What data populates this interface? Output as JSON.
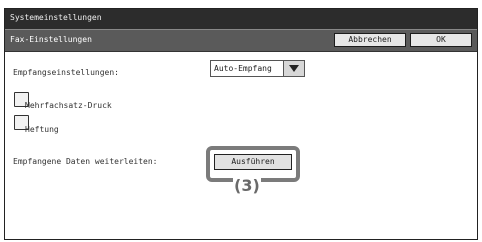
{
  "window": {
    "title": "Systemeinstellungen"
  },
  "header": {
    "title": "Fax-Einstellungen",
    "cancel_label": "Abbrechen",
    "ok_label": "OK"
  },
  "settings": {
    "receive_label": "Empfangseinstellungen:",
    "receive_value": "Auto-Empfang",
    "multiset_label": "Mehrfachsatz-Druck",
    "staple_label": "Heftung",
    "forward_label": "Empfangene Daten weiterleiten:",
    "execute_label": "Ausführen"
  },
  "callout": {
    "label": "(3)"
  },
  "icons": {
    "dropdown": "chevron-down-icon"
  }
}
